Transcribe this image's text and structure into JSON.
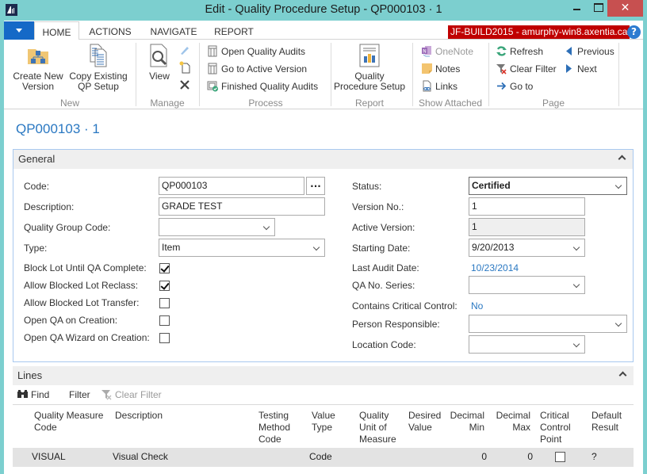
{
  "window": {
    "title": "Edit - Quality Procedure Setup - QP000103 · 1",
    "close_glyph": "✕"
  },
  "ribbon": {
    "tabs": [
      {
        "label": "HOME",
        "active": true
      },
      {
        "label": "ACTIONS",
        "active": false
      },
      {
        "label": "NAVIGATE",
        "active": false
      },
      {
        "label": "REPORT",
        "active": false
      }
    ],
    "server_badge": "JF-BUILD2015 - amurphy-win8.axentia.ca",
    "help_glyph": "?",
    "groups": {
      "new": {
        "label": "New",
        "create_new_version": "Create New Version",
        "create_new_version_l1": "Create New",
        "create_new_version_l2": "Version",
        "copy_existing_l1": "Copy Existing",
        "copy_existing_l2": "QP Setup"
      },
      "manage": {
        "label": "Manage",
        "view": "View"
      },
      "process": {
        "label": "Process",
        "open_quality_audits": "Open Quality Audits",
        "go_to_active_version": "Go to Active Version",
        "finished_quality_audits": "Finished Quality Audits"
      },
      "report": {
        "label": "Report",
        "qps_l1": "Quality",
        "qps_l2": "Procedure Setup"
      },
      "show_attached": {
        "label": "Show Attached",
        "onenote": "OneNote",
        "notes": "Notes",
        "links": "Links"
      },
      "page": {
        "label": "Page",
        "refresh": "Refresh",
        "clear_filter": "Clear Filter",
        "go_to": "Go to",
        "previous": "Previous",
        "next": "Next"
      }
    }
  },
  "page": {
    "title": "QP000103 · 1"
  },
  "general": {
    "header": "General",
    "code": {
      "label": "Code:",
      "value": "QP000103",
      "lookup": "..."
    },
    "description": {
      "label": "Description:",
      "value": "GRADE TEST"
    },
    "quality_group_code": {
      "label": "Quality Group Code:",
      "value": ""
    },
    "type": {
      "label": "Type:",
      "value": "Item"
    },
    "block_lot_until_qa_complete": {
      "label": "Block Lot Until QA Complete:",
      "checked": true
    },
    "allow_blocked_lot_reclass": {
      "label": "Allow Blocked Lot Reclass:",
      "checked": true
    },
    "allow_blocked_lot_transfer": {
      "label": "Allow Blocked Lot Transfer:",
      "checked": false
    },
    "open_qa_on_creation": {
      "label": "Open QA on Creation:",
      "checked": false
    },
    "open_qa_wizard_on_creation": {
      "label": "Open QA Wizard on Creation:",
      "checked": false
    },
    "status": {
      "label": "Status:",
      "value": "Certified"
    },
    "version_no": {
      "label": "Version No.:",
      "value": "1"
    },
    "active_version": {
      "label": "Active Version:",
      "value": "1"
    },
    "starting_date": {
      "label": "Starting Date:",
      "value": "9/20/2013"
    },
    "last_audit_date": {
      "label": "Last Audit Date:",
      "value": "10/23/2014"
    },
    "qa_no_series": {
      "label": "QA No. Series:",
      "value": ""
    },
    "contains_critical_control": {
      "label": "Contains Critical Control:",
      "value": "No"
    },
    "person_responsible": {
      "label": "Person Responsible:",
      "value": ""
    },
    "location_code": {
      "label": "Location Code:",
      "value": ""
    }
  },
  "lines": {
    "header": "Lines",
    "toolbar": {
      "find": "Find",
      "filter": "Filter",
      "clear_filter": "Clear Filter"
    },
    "columns": [
      {
        "l1": "Quality Measure",
        "l2": "Code",
        "l3": ""
      },
      {
        "l1": "Description",
        "l2": "",
        "l3": ""
      },
      {
        "l1": "Testing",
        "l2": "Method",
        "l3": "Code"
      },
      {
        "l1": "Value",
        "l2": "Type",
        "l3": ""
      },
      {
        "l1": "Quality",
        "l2": "Unit of",
        "l3": "Measure"
      },
      {
        "l1": "Desired",
        "l2": "Value",
        "l3": ""
      },
      {
        "l1": "Decimal",
        "l2": "Min",
        "l3": ""
      },
      {
        "l1": "Decimal",
        "l2": "Max",
        "l3": ""
      },
      {
        "l1": "Critical",
        "l2": "Control",
        "l3": "Point"
      },
      {
        "l1": "Default",
        "l2": "Result",
        "l3": ""
      }
    ],
    "rows": [
      {
        "quality_measure_code": "VISUAL",
        "description": "Visual Check",
        "testing_method_code": "",
        "value_type": "Code",
        "quality_unit_of_measure": "",
        "desired_value": "",
        "decimal_min": "0",
        "decimal_max": "0",
        "critical_control_point": false,
        "default_result": "?"
      }
    ]
  }
}
